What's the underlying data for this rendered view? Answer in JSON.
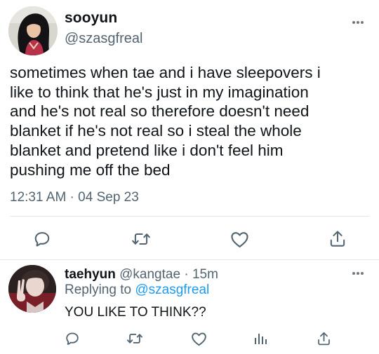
{
  "main_tweet": {
    "display_name": "sooyun",
    "handle": "@szasgfreal",
    "text": "sometimes when tae and i have sleepovers i\nlike to think that he's just in my imagination\nand he's not real so therefore doesn't need\nblanket if he's not real so i steal the whole\nblanket and pretend like i don't feel him\npushing me off the bed",
    "time": "12:31 AM · 04 Sep 23",
    "actions": [
      "reply-icon",
      "retweet-icon",
      "like-icon",
      "share-icon"
    ]
  },
  "reply_tweet": {
    "display_name": "taehyun",
    "handle": "@kangtae",
    "separator": "·",
    "age": "15m",
    "replying_label": "Replying to",
    "replying_handle": "@szasgfreal",
    "text": "YOU LIKE TO THINK??",
    "actions": [
      "reply-icon",
      "retweet-icon",
      "like-icon",
      "analytics-icon",
      "share-icon"
    ]
  },
  "colors": {
    "text_primary": "#0f1419",
    "text_secondary": "#536471",
    "link": "#1d9bf0",
    "divider": "#e3e7ea"
  }
}
